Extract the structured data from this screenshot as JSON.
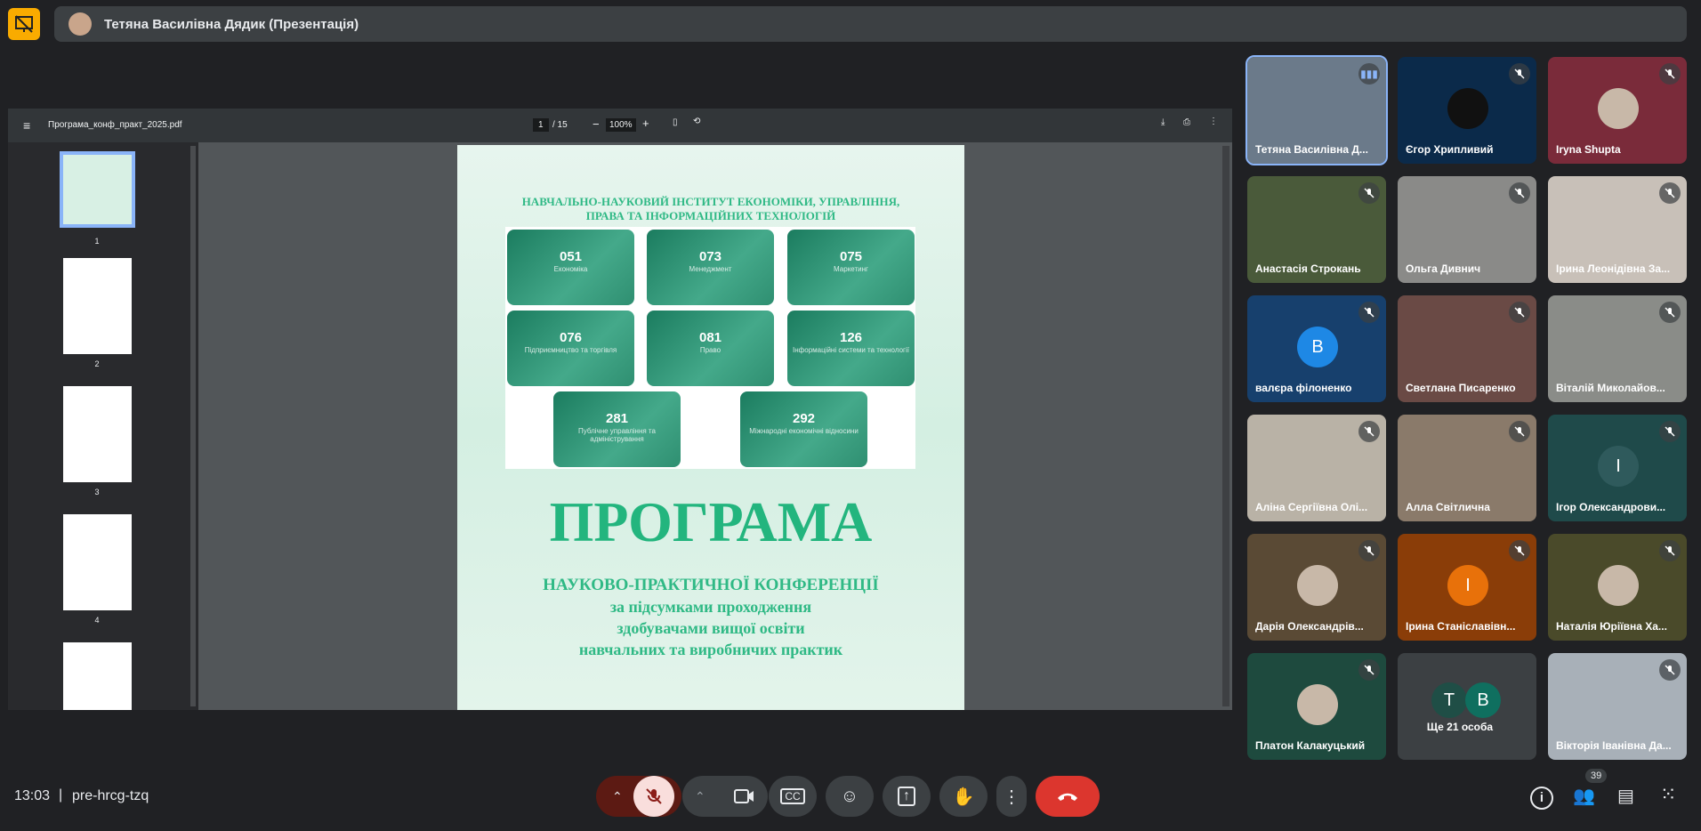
{
  "header": {
    "presenter_title": "Тетяна Василівна Дядик (Презентація)",
    "icon": "present-off-icon"
  },
  "pdf": {
    "filename": "Програма_конф_практ_2025.pdf",
    "current_page": "1",
    "total_pages": "/ 15",
    "zoom": "100%",
    "thumbnails": [
      "1",
      "2",
      "3",
      "4"
    ],
    "page": {
      "institute": "НАВЧАЛЬНО-НАУКОВИЙ ІНСТИТУТ ЕКОНОМІКИ, УПРАВЛІННЯ,",
      "institute2": "ПРАВА ТА ІНФОРМАЦІЙНИХ ТЕХНОЛОГІЙ",
      "tiles": [
        {
          "num": "051",
          "label": "Економіка"
        },
        {
          "num": "073",
          "label": "Менеджмент"
        },
        {
          "num": "075",
          "label": "Маркетинг"
        },
        {
          "num": "076",
          "label": "Підприємництво та торгівля"
        },
        {
          "num": "081",
          "label": "Право"
        },
        {
          "num": "126",
          "label": "Інформаційні системи та технології"
        },
        {
          "num": "281",
          "label": "Публічне управління та адміністрування"
        },
        {
          "num": "292",
          "label": "Міжнародні економічні відносини"
        }
      ],
      "title": "ПРОГРАМА",
      "line1": "НАУКОВО-ПРАКТИЧНОЇ КОНФЕРЕНЦІЇ",
      "line2": "за підсумками проходження",
      "line3": "здобувачами вищої освіти",
      "line4": "навчальних та виробничих практик"
    }
  },
  "participants": [
    {
      "name": "Тетяна Василівна Д...",
      "bg": "#6b7a8a",
      "speaking": true
    },
    {
      "name": "Єгор Хрипливий",
      "bg": "#0b2a4a",
      "avatar_dark": true
    },
    {
      "name": "Iryna Shupta",
      "bg": "#7a2b3a",
      "photo": true
    },
    {
      "name": "Анастасія Строкань",
      "bg": "#4a5a3a"
    },
    {
      "name": "Ольга Дивнич",
      "bg": "#8a8a88"
    },
    {
      "name": "Ірина Леонідівна За...",
      "bg": "#c8c0b8"
    },
    {
      "name": "валєра філоненко",
      "bg": "#17406d",
      "initial": "В",
      "color": "#1e88e5"
    },
    {
      "name": "Светлана Писаренко",
      "bg": "#6a4a45"
    },
    {
      "name": "Віталій Миколайов...",
      "bg": "#8a8c88"
    },
    {
      "name": "Аліна Сергіївна Олі...",
      "bg": "#b9b2a6"
    },
    {
      "name": "Алла Світлична",
      "bg": "#8a7a6a"
    },
    {
      "name": "Ігор Олександрови...",
      "bg": "#1f4a4a",
      "initial": "І",
      "color": "#2f5a5c"
    },
    {
      "name": "Дарія Олександрів...",
      "bg": "#5a4a35",
      "photo": true
    },
    {
      "name": "Ірина Станіславівн...",
      "bg": "#8a3d08",
      "initial": "І",
      "color": "#e8710a"
    },
    {
      "name": "Наталія Юріївна Ха...",
      "bg": "#4a4a2a",
      "photo": true
    },
    {
      "name": "Платон Калакуцький",
      "bg": "#1e4a3e",
      "photo": true
    },
    {
      "name": "Ще 21 особа",
      "bg": "#3c4043",
      "others": [
        "Т",
        "В"
      ]
    },
    {
      "name": "Вікторія Іванівна Да...",
      "bg": "#a8b0b8"
    }
  ],
  "footer": {
    "time": "13:03",
    "separator": "|",
    "meeting_code": "pre-hrcg-tzq",
    "people_count": "39"
  }
}
